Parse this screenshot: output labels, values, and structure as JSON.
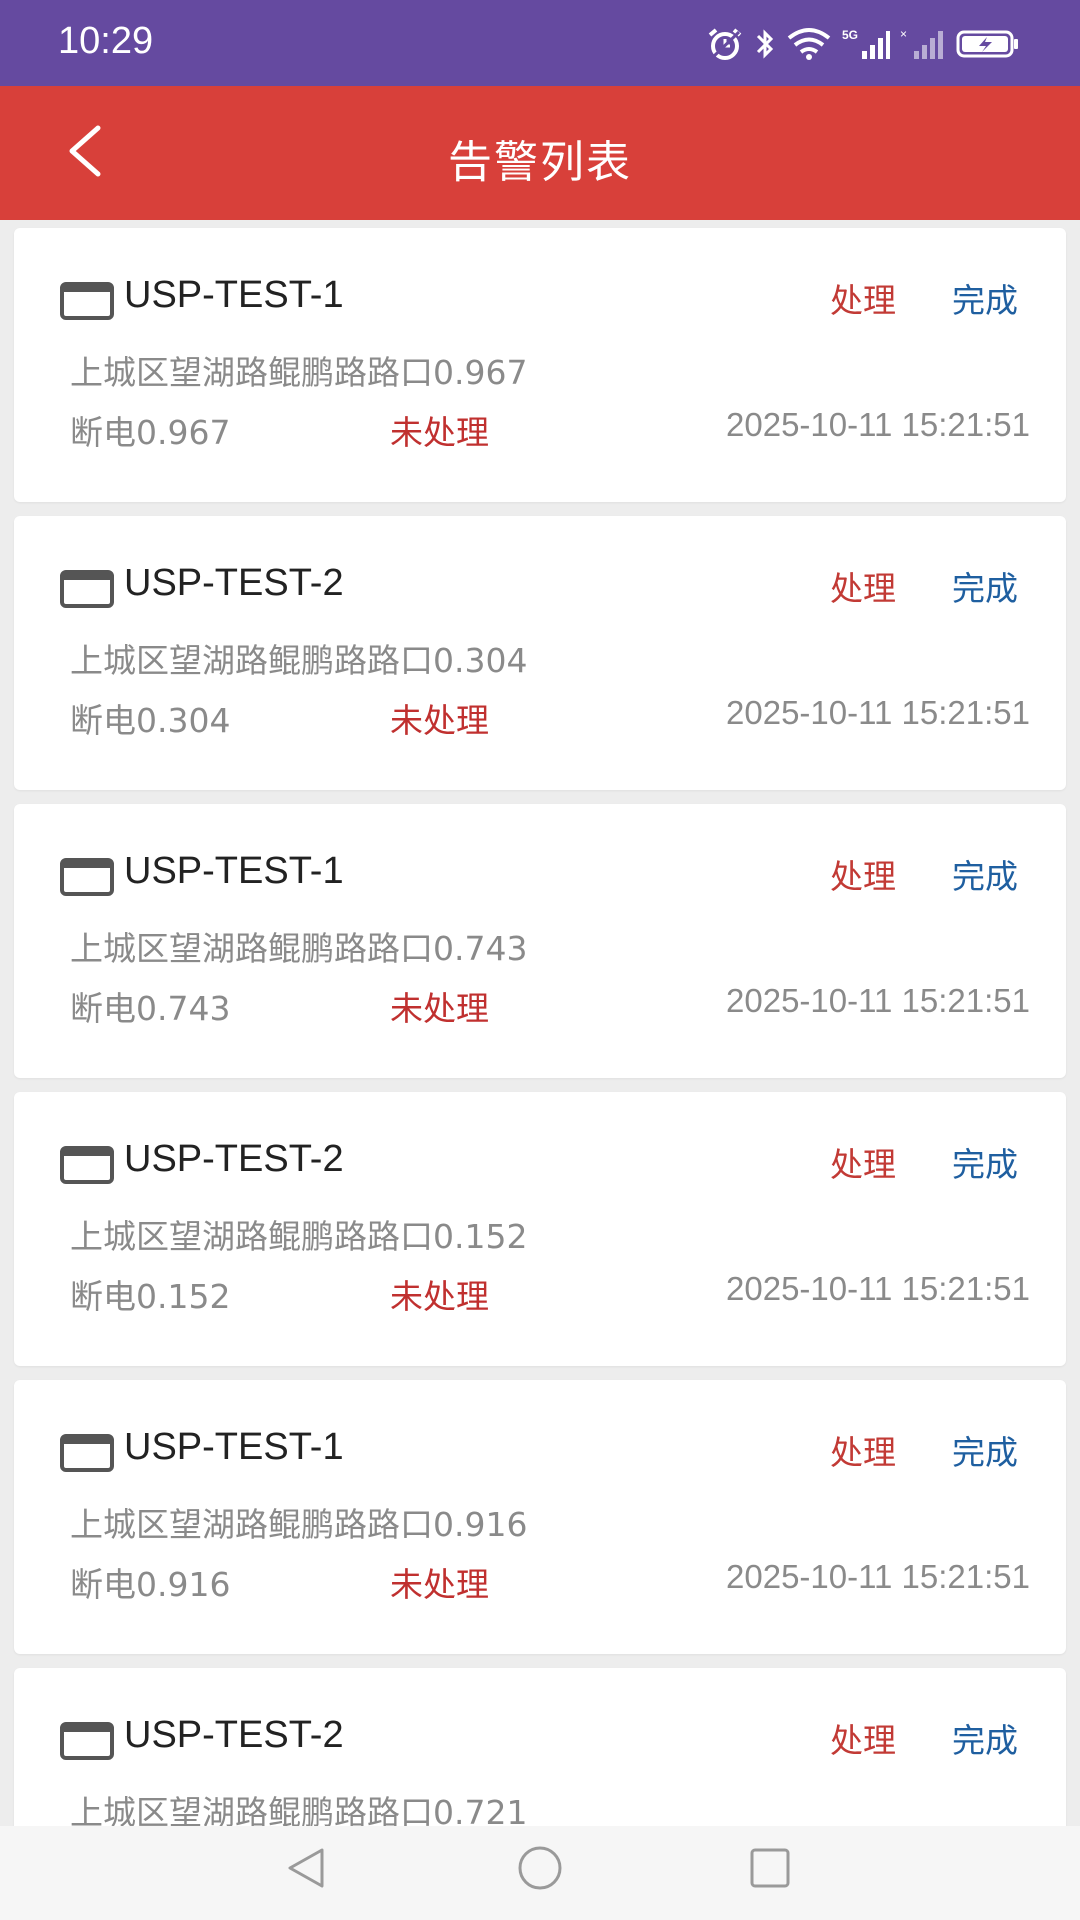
{
  "status_bar": {
    "time": "10:29",
    "icons": [
      "alarm-icon",
      "bluetooth-icon",
      "wifi-icon",
      "signal-5g-icon",
      "signal-icon",
      "battery-charging-icon"
    ]
  },
  "app_bar": {
    "title": "告警列表",
    "back_icon": "chevron-left-icon",
    "background": "#d8403a"
  },
  "colors": {
    "status_bar": "#654aa0",
    "process_button": "#c23a35",
    "done_button": "#1f5fa0",
    "unprocessed": "#c0302f"
  },
  "alarms": [
    {
      "device": "USP-TEST-1",
      "process_label": "处理",
      "done_label": "完成",
      "address": "上城区望湖路鲲鹏路路口0.967",
      "type": "断电0.967",
      "status": "未处理",
      "time": "2025-10-11 15:21:51"
    },
    {
      "device": "USP-TEST-2",
      "process_label": "处理",
      "done_label": "完成",
      "address": "上城区望湖路鲲鹏路路口0.304",
      "type": "断电0.304",
      "status": "未处理",
      "time": "2025-10-11 15:21:51"
    },
    {
      "device": "USP-TEST-1",
      "process_label": "处理",
      "done_label": "完成",
      "address": "上城区望湖路鲲鹏路路口0.743",
      "type": "断电0.743",
      "status": "未处理",
      "time": "2025-10-11 15:21:51"
    },
    {
      "device": "USP-TEST-2",
      "process_label": "处理",
      "done_label": "完成",
      "address": "上城区望湖路鲲鹏路路口0.152",
      "type": "断电0.152",
      "status": "未处理",
      "time": "2025-10-11 15:21:51"
    },
    {
      "device": "USP-TEST-1",
      "process_label": "处理",
      "done_label": "完成",
      "address": "上城区望湖路鲲鹏路路口0.916",
      "type": "断电0.916",
      "status": "未处理",
      "time": "2025-10-11 15:21:51"
    },
    {
      "device": "USP-TEST-2",
      "process_label": "处理",
      "done_label": "完成",
      "address": "上城区望湖路鲲鹏路路口0.721",
      "type": "",
      "status": "",
      "time": ""
    }
  ],
  "nav_bar": {
    "icons": [
      "nav-back-icon",
      "nav-home-icon",
      "nav-recents-icon"
    ]
  }
}
